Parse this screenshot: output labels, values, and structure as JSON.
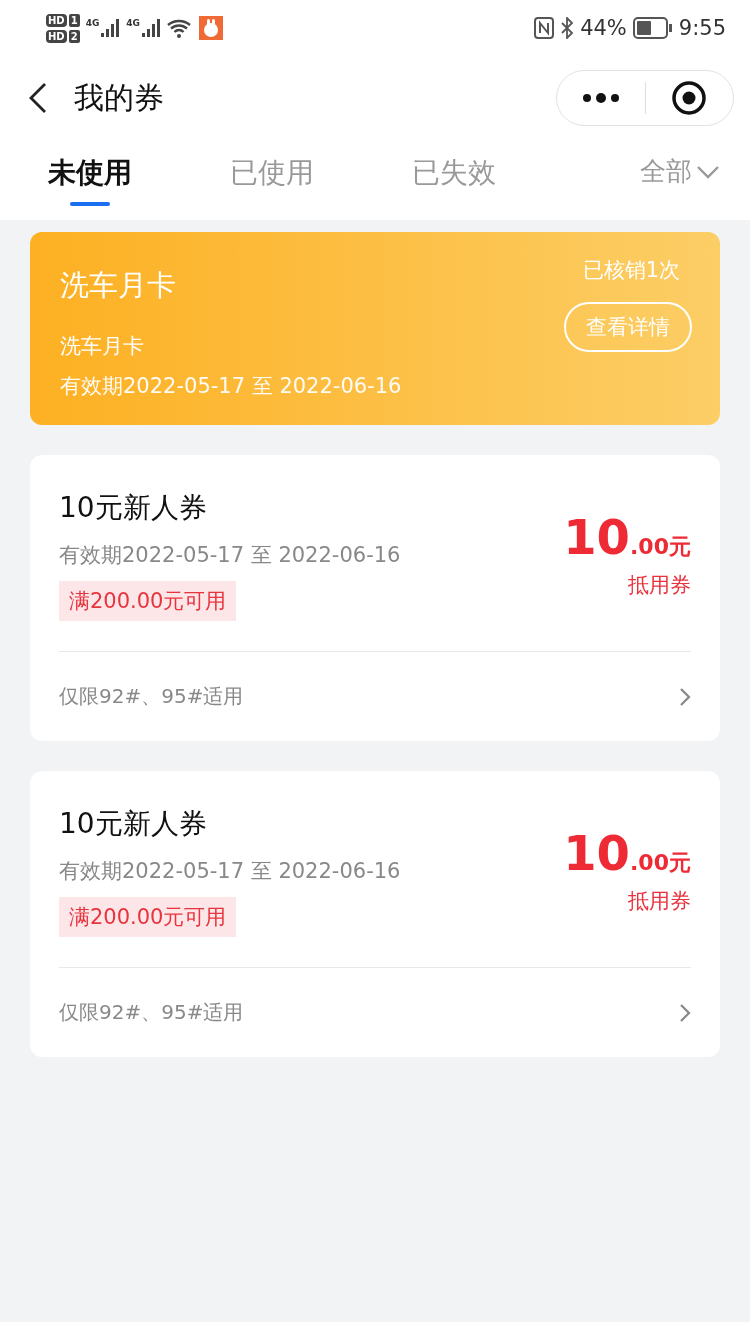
{
  "status_bar": {
    "sims": [
      {
        "label": "HD",
        "slot": "1"
      },
      {
        "label": "HD",
        "slot": "2"
      }
    ],
    "networks": [
      "4G",
      "4G"
    ],
    "battery": "44%",
    "time": "9:55"
  },
  "nav": {
    "title": "我的券"
  },
  "tabs": [
    {
      "label": "未使用",
      "selected": true
    },
    {
      "label": "已使用",
      "selected": false
    },
    {
      "label": "已失效",
      "selected": false
    }
  ],
  "filter": {
    "label": "全部"
  },
  "month_card": {
    "title": "洗车月卡",
    "subtitle": "洗车月卡",
    "validity": "有效期2022-05-17 至 2022-06-16",
    "usage": "已核销1次",
    "button": "查看详情"
  },
  "coupons": [
    {
      "title": "10元新人券",
      "validity": "有效期2022-05-17 至 2022-06-16",
      "condition": "满200.00元可用",
      "amount": "10",
      "amount_suffix": ".00元",
      "type": "抵用券",
      "scope": "仅限92#、95#适用"
    },
    {
      "title": "10元新人券",
      "validity": "有效期2022-05-17 至 2022-06-16",
      "condition": "满200.00元可用",
      "amount": "10",
      "amount_suffix": ".00元",
      "type": "抵用券",
      "scope": "仅限92#、95#适用"
    }
  ]
}
